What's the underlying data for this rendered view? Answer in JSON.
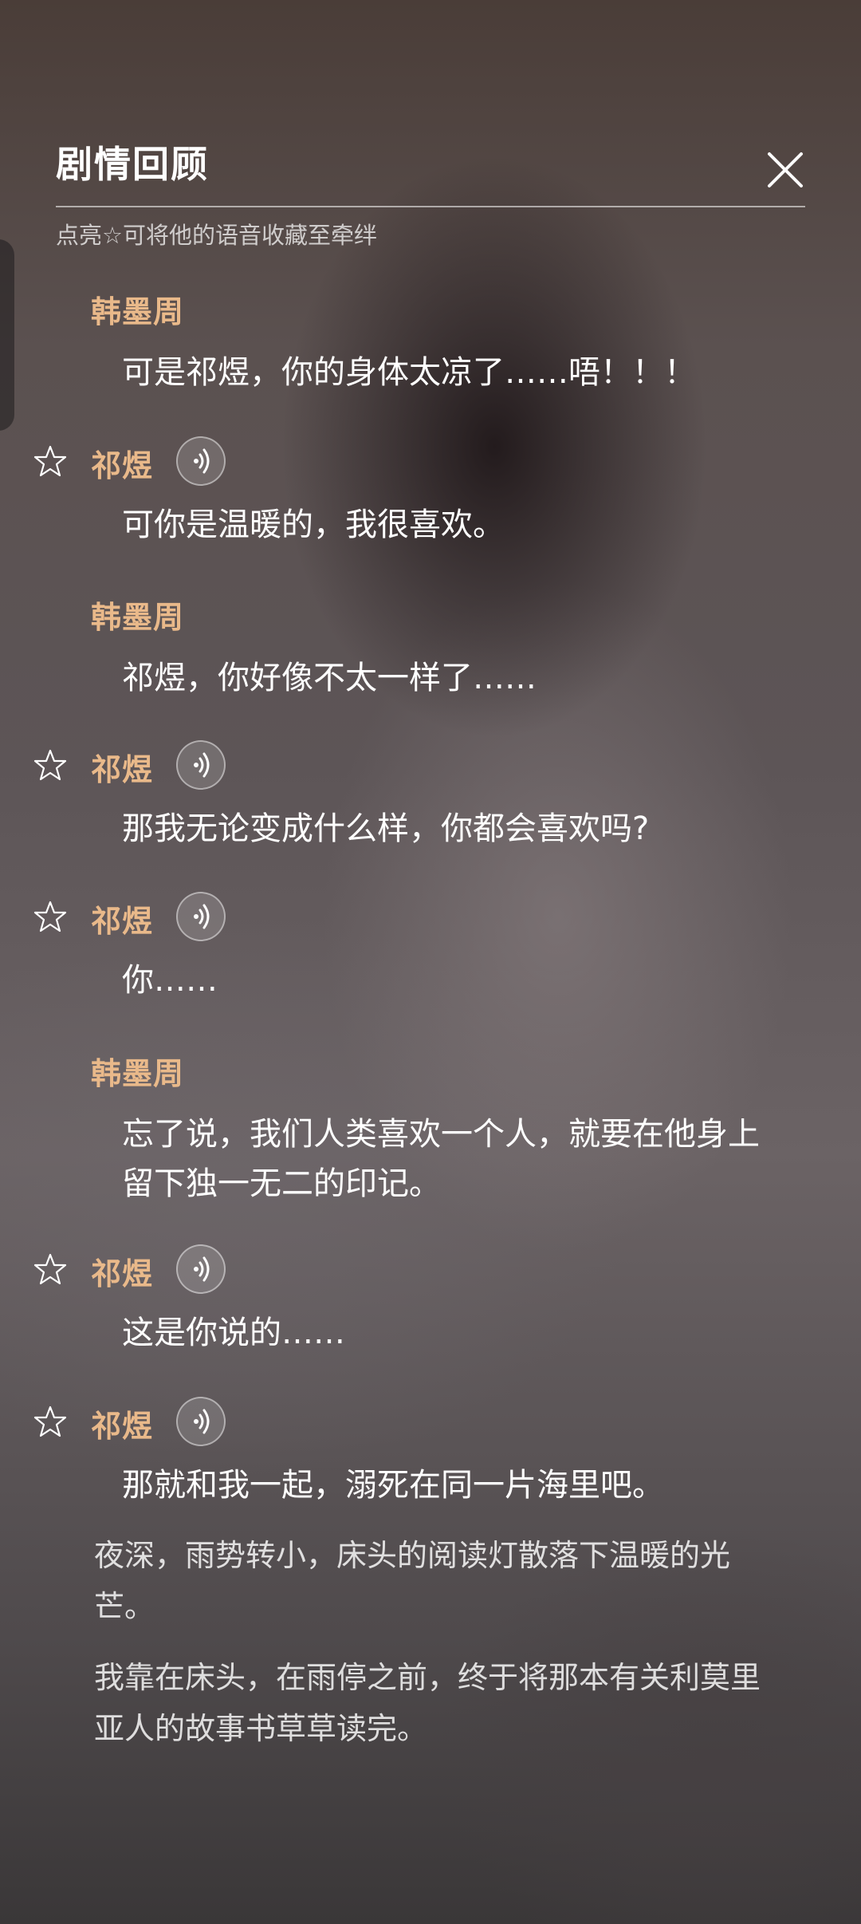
{
  "header": {
    "title": "剧情回顾",
    "subtitle": "点亮☆可将他的语音收藏至牵绊"
  },
  "icons": {
    "close": "close-icon",
    "star": "star-outline-icon",
    "voice": "voice-playback-icon"
  },
  "colors": {
    "speaker_name": "#e9b98a",
    "dialogue_text": "#ffffff"
  },
  "dialogue": [
    {
      "speaker": "韩墨周",
      "text": "可是祁煜，你的身体太凉了……唔！！！"
    },
    {
      "speaker": "祁煜",
      "text": "可你是温暖的，我很喜欢。"
    },
    {
      "speaker": "韩墨周",
      "text": "祁煜，你好像不太一样了……"
    },
    {
      "speaker": "祁煜",
      "text": "那我无论变成什么样，你都会喜欢吗?"
    },
    {
      "speaker": "祁煜",
      "text": "你……"
    },
    {
      "speaker": "韩墨周",
      "text": "忘了说，我们人类喜欢一个人，就要在他身上留下独一无二的印记。"
    },
    {
      "speaker": "祁煜",
      "text": "这是你说的……"
    },
    {
      "speaker": "祁煜",
      "text": "那就和我一起，溺死在同一片海里吧。"
    }
  ],
  "narration": [
    "夜深，雨势转小，床头的阅读灯散落下温暖的光芒。",
    "我靠在床头，在雨停之前，终于将那本有关利莫里亚人的故事书草草读完。"
  ]
}
